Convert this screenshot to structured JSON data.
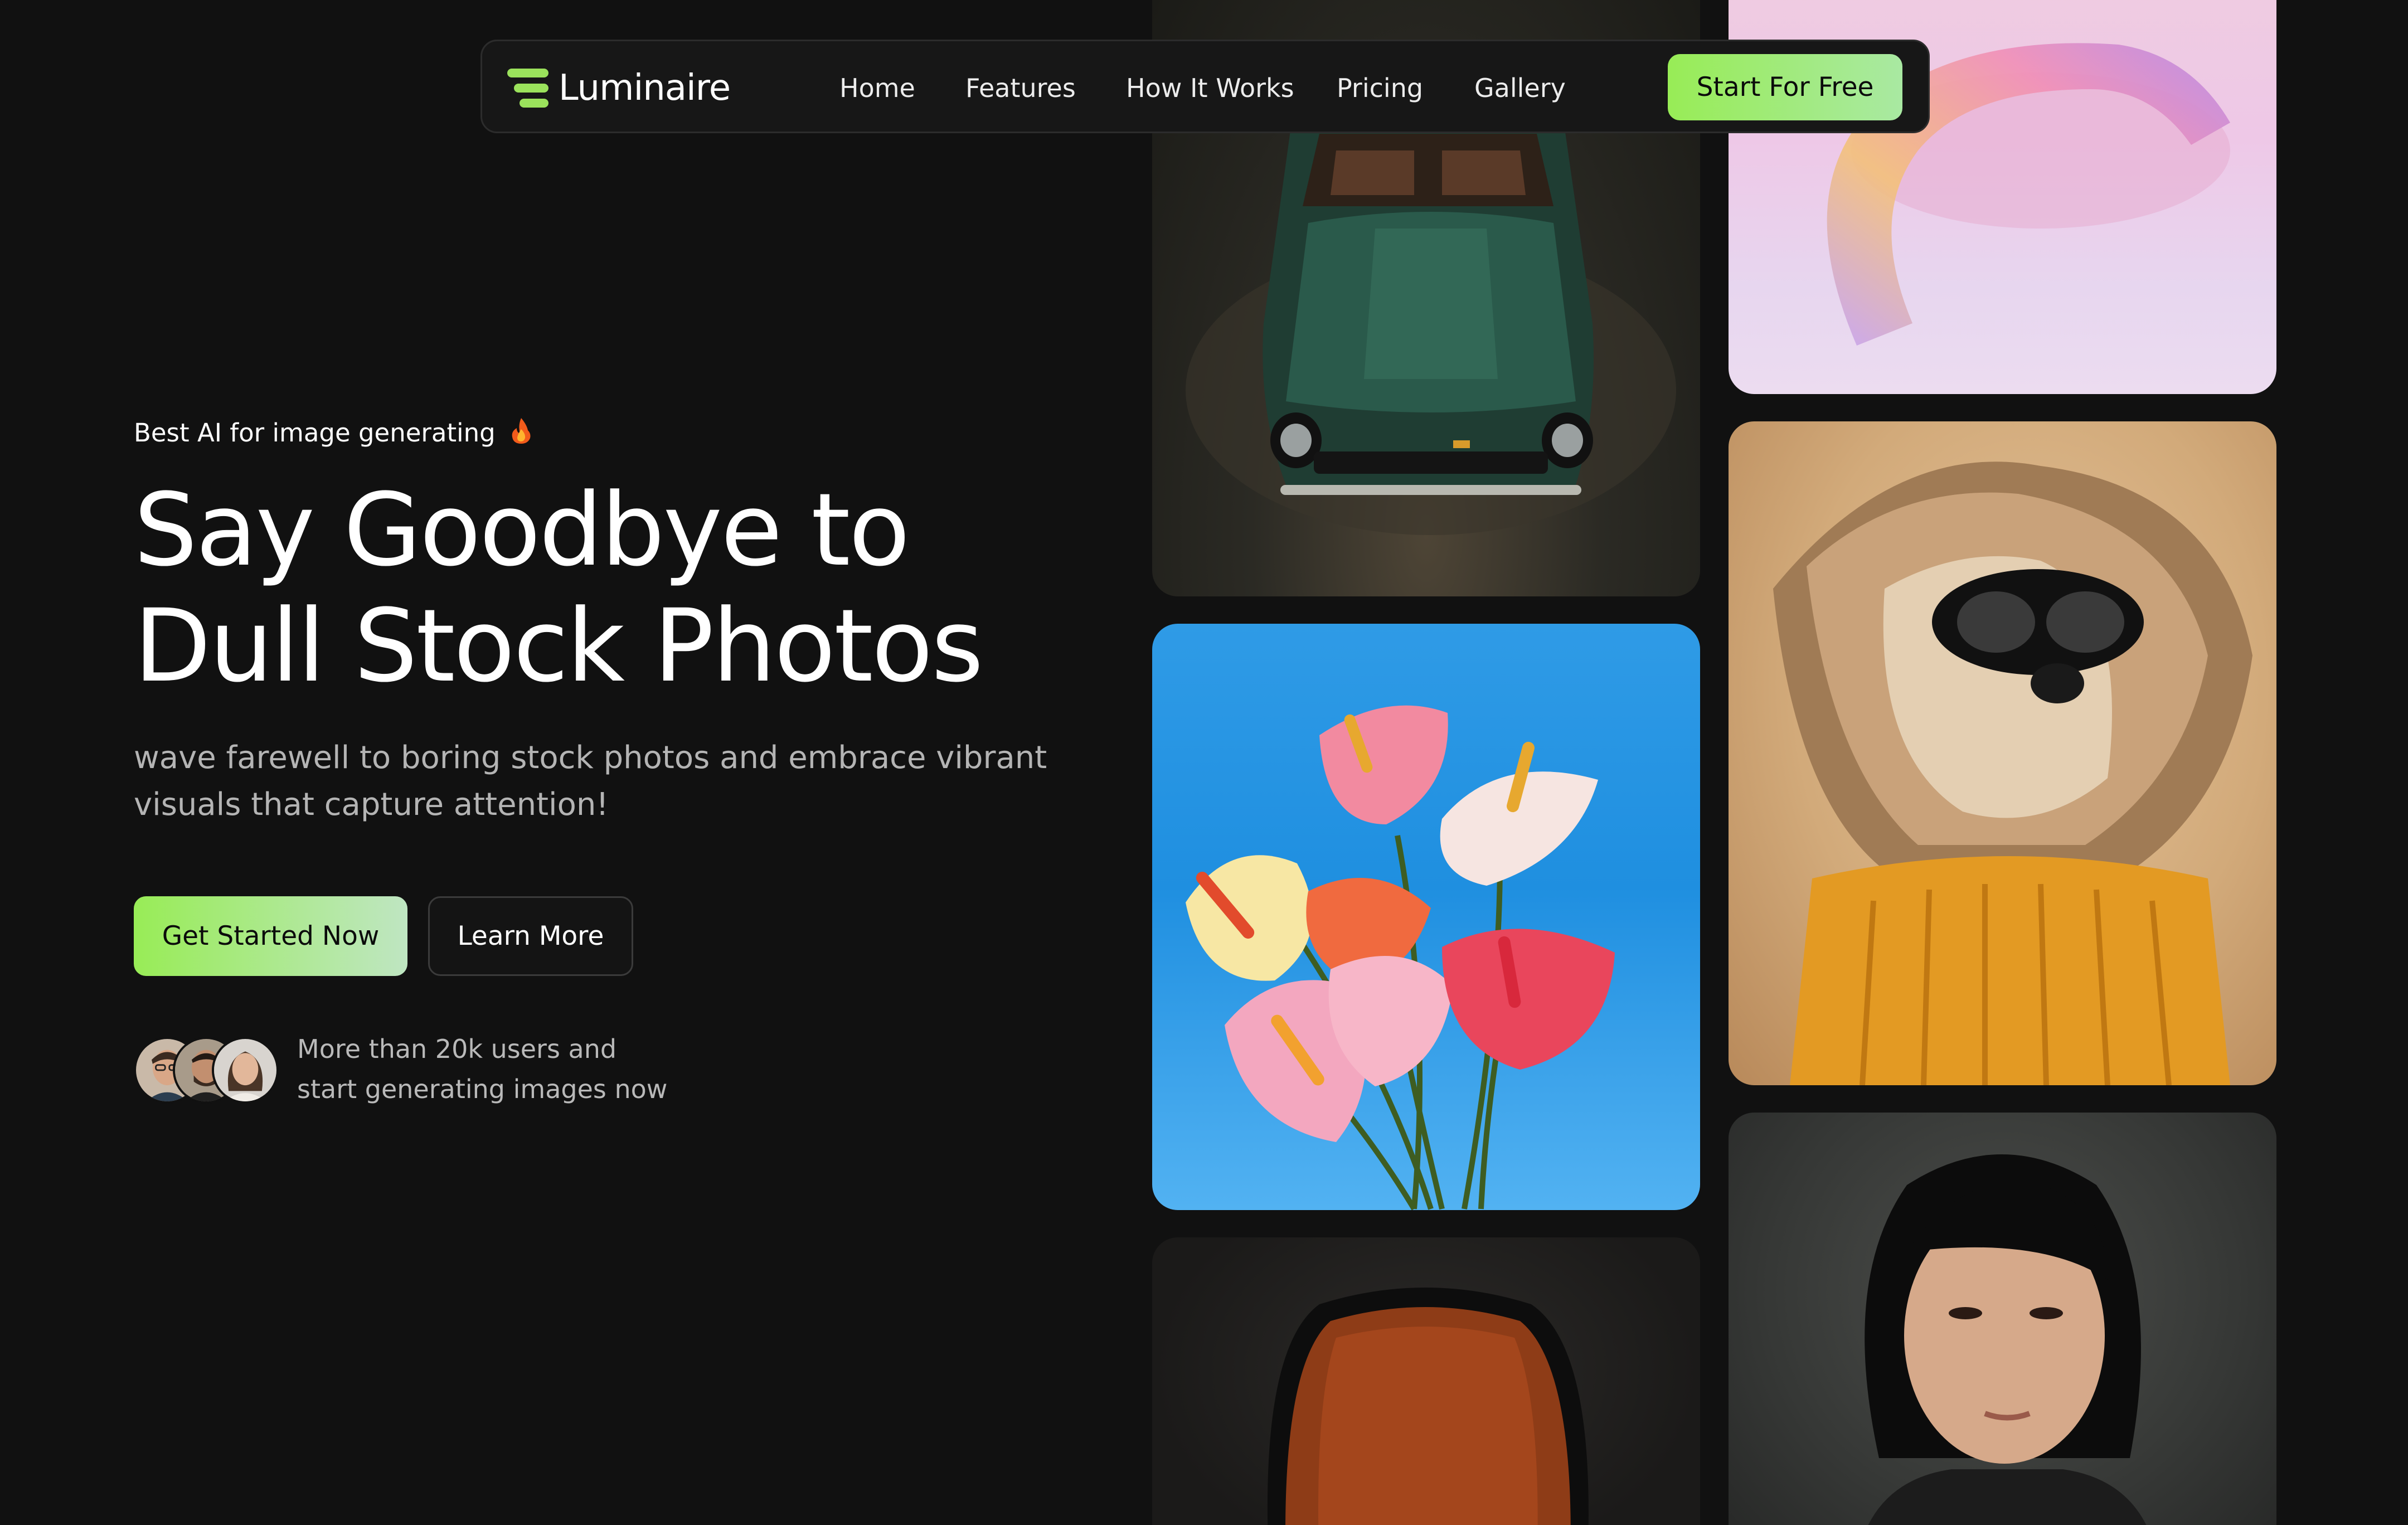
{
  "brand": {
    "name": "Luminaire",
    "accent": "#9be25c"
  },
  "nav": {
    "links": [
      "Home",
      "Features",
      "How It Works",
      "Pricing",
      "Gallery"
    ],
    "cta_label": "Start For Free"
  },
  "hero": {
    "eyebrow": "Best AI for image generating",
    "eyebrow_icon": "fire-icon",
    "title_line1": "Say Goodbye to",
    "title_line2": "Dull Stock Photos",
    "subtitle": "wave farewell to boring stock photos and embrace vibrant visuals that capture attention!",
    "primary_cta": "Get Started Now",
    "secondary_cta": "Learn More"
  },
  "social_proof": {
    "line1": "More than 20k users and",
    "line2": "start generating images now",
    "avatars": [
      "avatar-man-glasses",
      "avatar-man-beard",
      "avatar-woman"
    ]
  },
  "gallery": {
    "images": [
      "vintage-green-car",
      "anthurium-flowers",
      "leather-chair",
      "pastel-3d-arc",
      "dog-with-goggles",
      "woman-portrait"
    ]
  },
  "colors": {
    "background": "#111111",
    "navbar": "#171717",
    "cta_gradient_start": "#98ec56",
    "cta_gradient_end": "#a9e9a2"
  }
}
